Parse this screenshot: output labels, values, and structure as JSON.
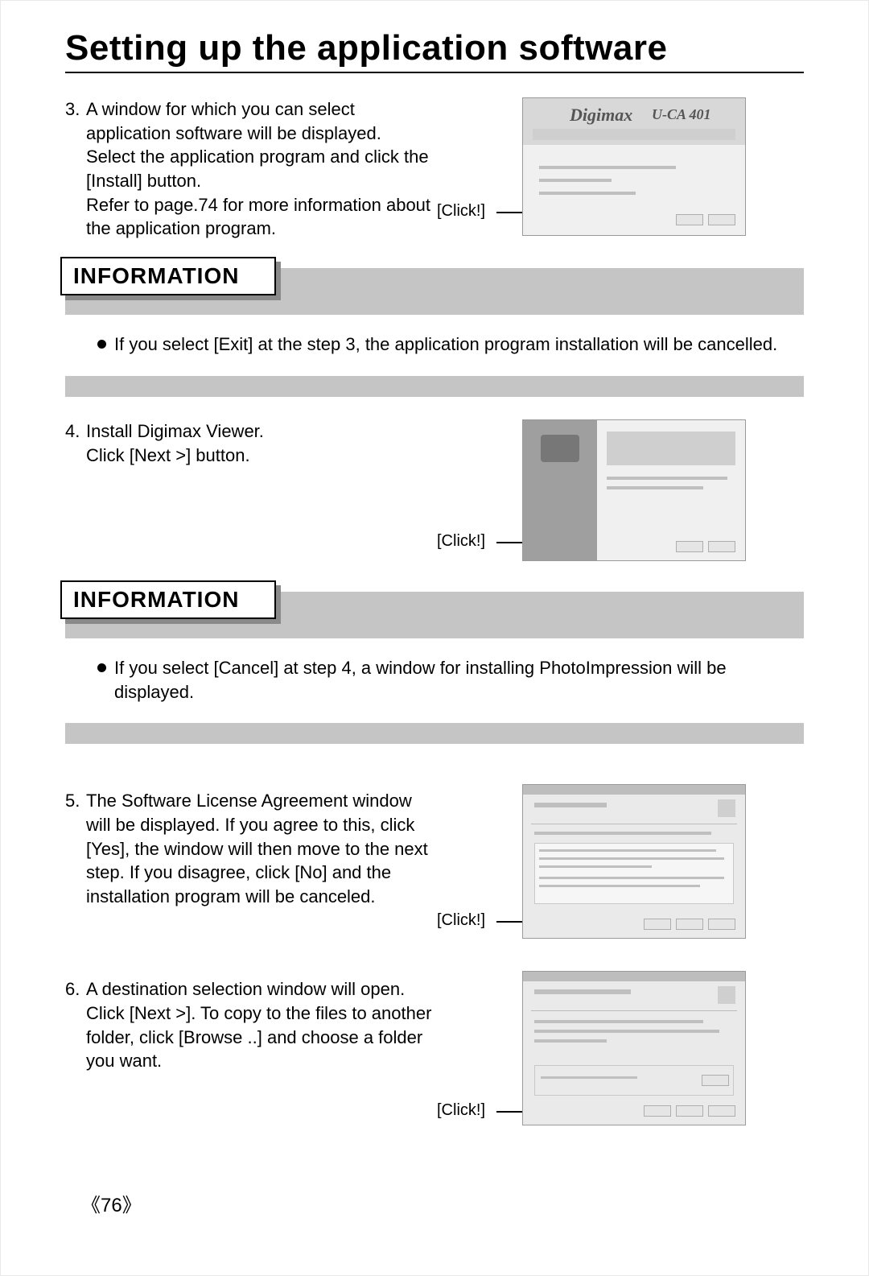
{
  "title": "Setting up the application software",
  "page_number": "《76》",
  "steps": {
    "s3": {
      "num": "3.",
      "text_a": "A window for which you can select application software will be displayed. Select the application program and click the [Install] button.",
      "text_b": "Refer to page.74 for more information about the application program.",
      "click": "[Click!]",
      "thumb_title": "Digimax",
      "thumb_model": "U-CA 401"
    },
    "s4": {
      "num": "4.",
      "text_a": "Install Digimax Viewer.",
      "text_b": "Click [Next >] button.",
      "click": "[Click!]"
    },
    "s5": {
      "num": "5.",
      "text_a": "The Software License Agreement window will be displayed. If you agree to this, click [Yes], the window will then move to the next step.",
      "text_b": "If you disagree, click [No] and the installation program will be canceled.",
      "click": "[Click!]"
    },
    "s6": {
      "num": "6.",
      "text_a": "A destination selection window will open. Click [Next >]. To copy to the files to another folder, click [Browse ..] and choose a folder you want.",
      "click": "[Click!]"
    }
  },
  "info": {
    "heading": "INFORMATION",
    "box1": "If you select [Exit] at the step 3, the application program installation will be cancelled.",
    "box2": "If you select [Cancel] at step 4, a window for installing PhotoImpression will be displayed."
  }
}
